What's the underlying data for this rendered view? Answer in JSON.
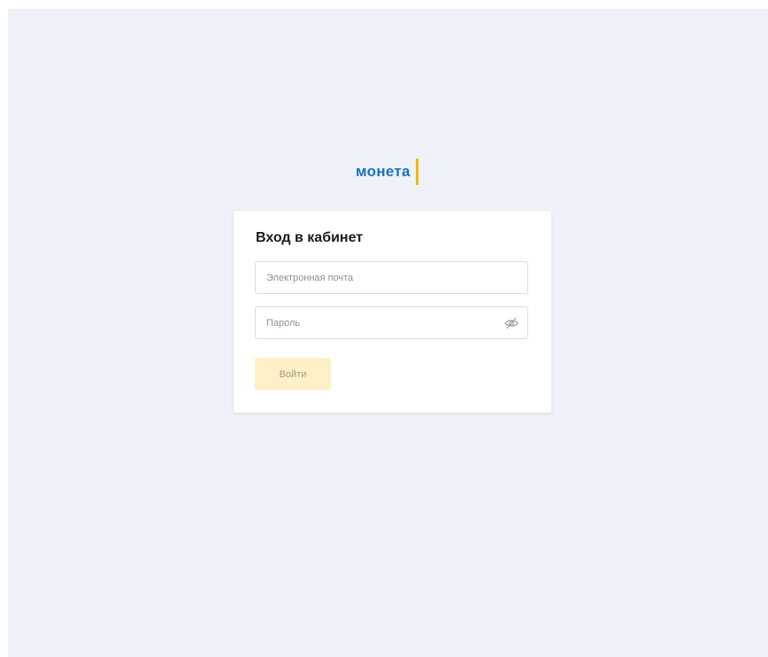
{
  "brand": {
    "logo_text": "монета",
    "logo_color": "#1a73b8",
    "accent_color": "#f5b400"
  },
  "login": {
    "title": "Вход в кабинет",
    "email": {
      "placeholder": "Электронная почта",
      "value": ""
    },
    "password": {
      "placeholder": "Пароль",
      "value": "",
      "visibility_icon": "eye-off-icon"
    },
    "submit_label": "Войти",
    "submit_color": "#fdf0c7"
  },
  "colors": {
    "background": "#eff1f8",
    "card": "#ffffff"
  }
}
